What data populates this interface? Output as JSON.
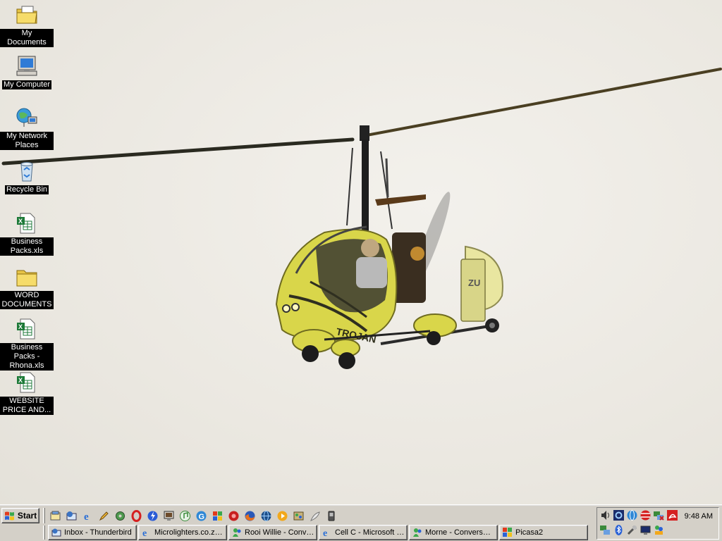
{
  "desktop": {
    "icons": [
      {
        "label": "My Documents",
        "icon": "folder-documents-icon"
      },
      {
        "label": "My Computer",
        "icon": "computer-icon"
      },
      {
        "label": "My Network Places",
        "icon": "network-icon"
      },
      {
        "label": "Recycle Bin",
        "icon": "recycle-bin-icon"
      },
      {
        "label": "Business Packs.xls",
        "icon": "excel-file-icon"
      },
      {
        "label": "WORD DOCUMENTS",
        "icon": "folder-icon"
      },
      {
        "label": "Business Packs - Rhona.xls",
        "icon": "excel-file-icon"
      },
      {
        "label": "WEBSITE PRICE AND...",
        "icon": "excel-file-icon"
      }
    ],
    "wallpaper": {
      "subject": "gyrocopter-photo",
      "fuselage_text": "TROJAN",
      "tail_text": "ZU"
    }
  },
  "taskbar": {
    "start_label": "Start",
    "quick_launch": [
      "show-desktop-icon",
      "thunderbird-icon",
      "internet-explorer-icon",
      "pencil-icon",
      "gear-globe-icon",
      "opera-icon",
      "winamp-icon",
      "monitor-icon",
      "itunes-icon",
      "google-icon",
      "picasa-icon",
      "red-circle-icon",
      "firefox-icon",
      "globe-icon",
      "media-player-icon",
      "palette-icon",
      "feather-icon",
      "device-icon"
    ],
    "tasks": [
      {
        "label": "Inbox - Thunderbird",
        "icon": "thunderbird-icon"
      },
      {
        "label": "Microlighters.co.za ...",
        "icon": "internet-explorer-icon"
      },
      {
        "label": "Rooi Willie - Conve...",
        "icon": "messenger-icon"
      },
      {
        "label": "Cell C - Microsoft In...",
        "icon": "internet-explorer-icon"
      },
      {
        "label": "Morne - Conversation",
        "icon": "messenger-icon"
      },
      {
        "label": "Picasa2",
        "icon": "picasa-icon"
      }
    ],
    "tray": {
      "icons": [
        "volume-icon",
        "radio-icon",
        "globe-icon",
        "antivirus-icon",
        "network-disconnected-icon",
        "acrobat-icon",
        "network-icon",
        "bluetooth-icon",
        "tools-icon",
        "display-icon",
        "people-icon"
      ],
      "clock": "9:48 AM"
    }
  },
  "colors": {
    "taskbar": "#d4d0c8",
    "label_bg": "#000000",
    "label_text": "#ffffff",
    "gyro_yellow": "#d9d64a"
  }
}
